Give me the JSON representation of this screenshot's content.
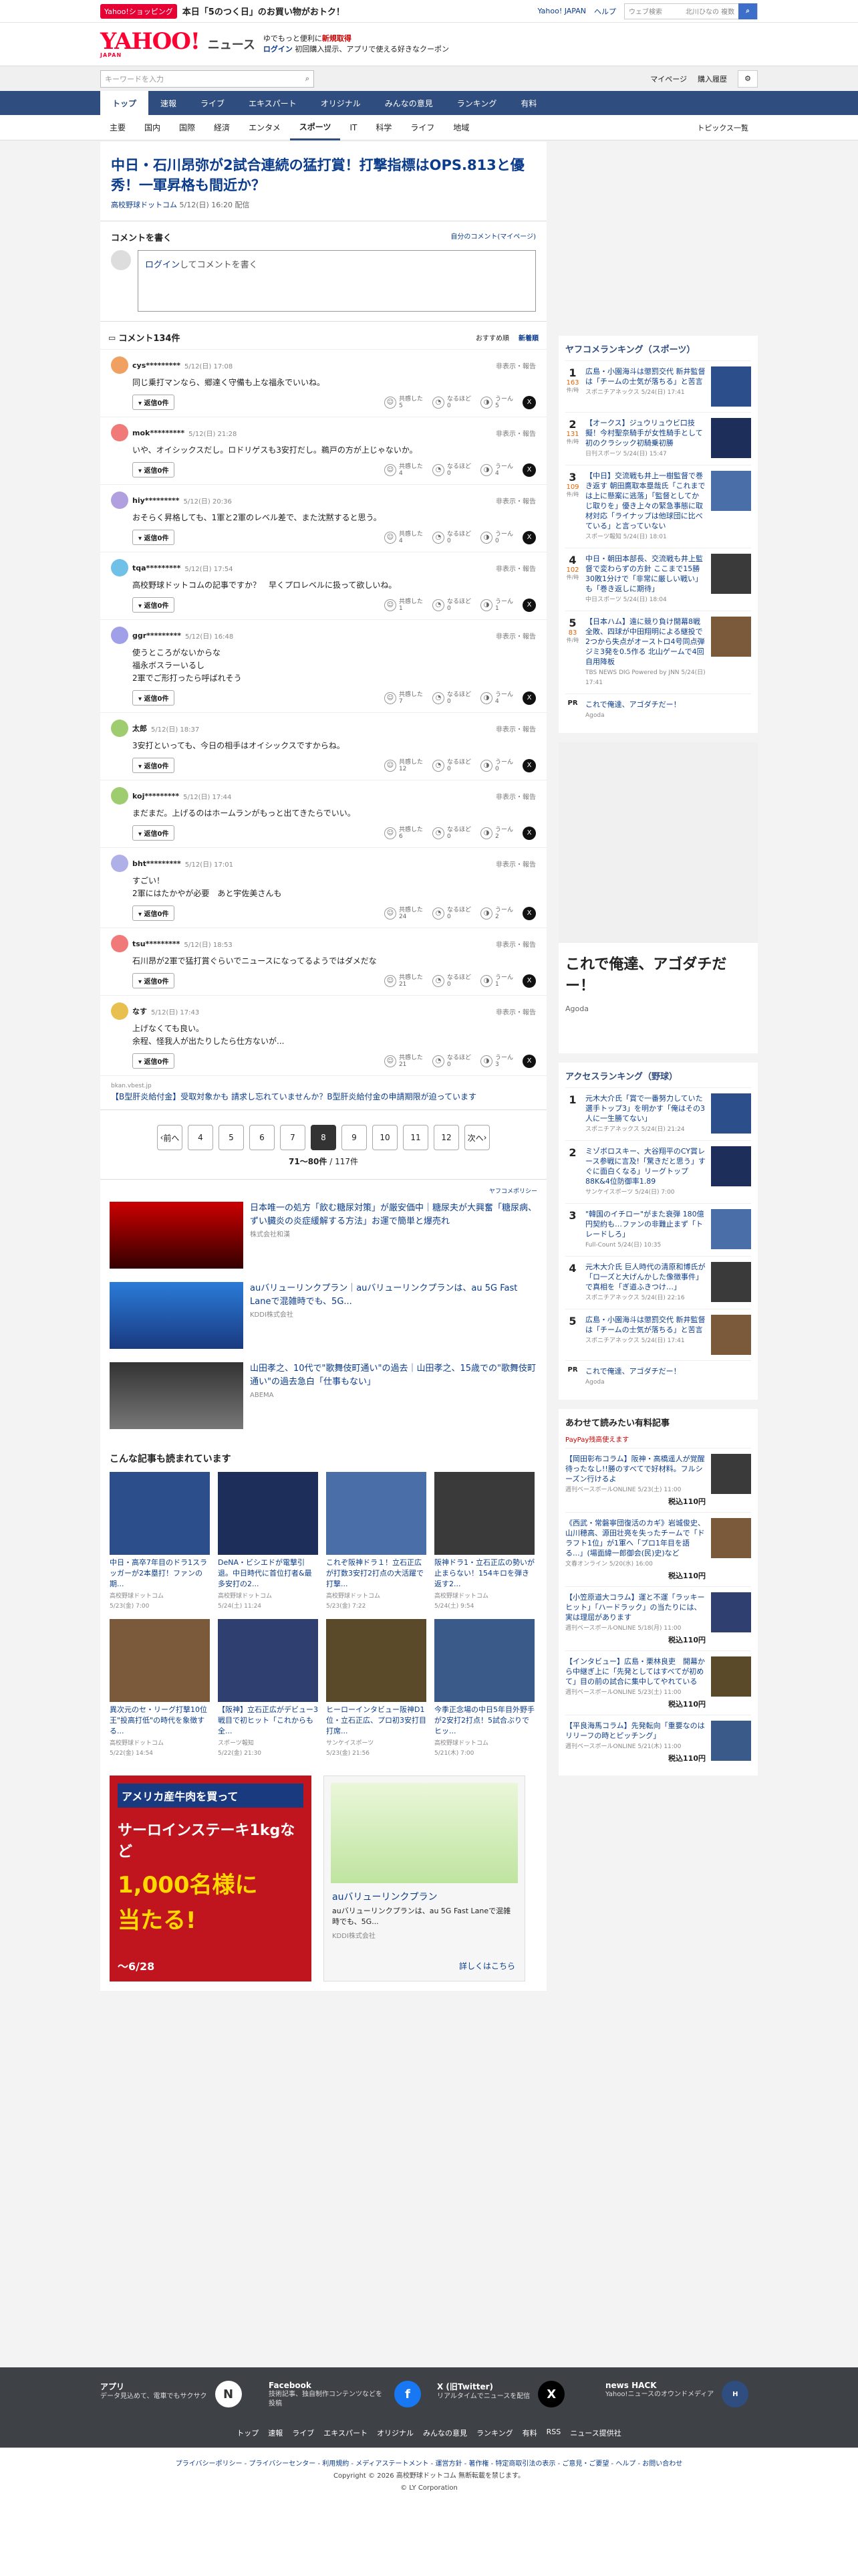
{
  "topbar": {
    "shop_badge": "Yahoo!ショッピング",
    "shop_text": "本日「5のつく日」のお買い物がおトク！",
    "links": [
      "Yahoo! JAPAN",
      "ヘルプ"
    ],
    "search_placeholder": "ウェブ検索",
    "search_suggest": "北川ひなの 複数"
  },
  "header": {
    "logo": "YAHOO!",
    "logo_sub": "JAPAN",
    "news": "ニュース",
    "promo1_a": "ゆでもっと便利に",
    "promo1_b": "新規取得",
    "promo2_a": "ログイン",
    "promo2_b": "初回購入提示、アプリで使える好きなクーポン"
  },
  "search": {
    "placeholder": "キーワードを入力",
    "mypage": "マイページ",
    "purchase": "購入履歴"
  },
  "catnav": [
    "トップ",
    "速報",
    "ライブ",
    "エキスパート",
    "オリジナル",
    "みんなの意見",
    "ランキング",
    "有料"
  ],
  "subnav": [
    "主要",
    "国内",
    "国際",
    "経済",
    "エンタメ",
    "スポーツ",
    "IT",
    "科学",
    "ライフ",
    "地域"
  ],
  "subnav_right": "トピックス一覧",
  "article": {
    "title": "中日・石川昂弥が2試合連続の猛打賞！打撃指標はOPS.813と優秀！一軍昇格も間近か？",
    "source": "高校野球ドットコム",
    "date": "5/12(日) 16:20 配信"
  },
  "comment_write": {
    "title": "コメントを書く",
    "mine": "自分のコメント(マイページ)",
    "login": "ログイン",
    "prompt": "してコメントを書く"
  },
  "comment_list": {
    "title": "コメント134件",
    "sort1": "おすすめ順",
    "sort2": "新着順"
  },
  "labels": {
    "flags": "非表示・報告",
    "reply": "返信0件",
    "r1": "共感した",
    "r2": "なるほど",
    "r3": "うーん"
  },
  "comments": [
    {
      "user": "cys*********",
      "date": "5/12(日) 17:08",
      "body": "同じ乗打マンなら、郷達く守備も上な福永でいいね。",
      "c": "5",
      "n": "0",
      "u": "5",
      "color": "#f0a060"
    },
    {
      "user": "mok*********",
      "date": "5/12(日) 21:28",
      "body": "いや、オイシックスだし。ロドリゲスも3安打だし。鵜戸の方が上じゃないか。",
      "c": "4",
      "n": "0",
      "u": "4",
      "color": "#f07a7a"
    },
    {
      "user": "hiy*********",
      "date": "5/12(日) 20:36",
      "body": "おそらく昇格しても、1軍と2軍のレベル差で、また沈黙すると思う。",
      "c": "4",
      "n": "0",
      "u": "0",
      "color": "#b0a0e0"
    },
    {
      "user": "tqa*********",
      "date": "5/12(日) 17:54",
      "body": "高校野球ドットコムの記事ですか？　早くプロレベルに扱って欲しいね。",
      "c": "1",
      "n": "0",
      "u": "1",
      "color": "#70c0e8"
    },
    {
      "user": "ggr*********",
      "date": "5/12(日) 16:48",
      "body": "使うところがないからな\n福永ボスラーいるし\n2軍でご形打ったら呼ばれそう",
      "c": "7",
      "n": "0",
      "u": "4",
      "color": "#a0a0e8"
    },
    {
      "user": "太郎",
      "date": "5/12(日) 18:37",
      "body": "3安打といっても、今日の相手はオイシックスですからね。",
      "c": "12",
      "n": "0",
      "u": "0",
      "color": "#a0cc70"
    },
    {
      "user": "koj*********",
      "date": "5/12(日) 17:44",
      "body": "まだまだ。上げるのはホームランがもっと出てきたらでいい。",
      "c": "6",
      "n": "0",
      "u": "2",
      "color": "#a0cc70"
    },
    {
      "user": "bht*********",
      "date": "5/12(日) 17:01",
      "body": "すごい！\n2軍にはたかやが必要　あと宇佐美さんも",
      "c": "24",
      "n": "0",
      "u": "2",
      "color": "#b0b0e8"
    },
    {
      "user": "tsu*********",
      "date": "5/12(日) 18:53",
      "body": "石川昂が2軍で猛打賞ぐらいでニュースになってるようではダメだな",
      "c": "21",
      "n": "0",
      "u": "1",
      "color": "#f07a7a"
    },
    {
      "user": "なす",
      "date": "5/12(日) 17:43",
      "body": "上げなくても良い。\n余程、怪我人が出たりしたら仕方ないが...",
      "c": "21",
      "n": "0",
      "u": "3",
      "color": "#e8c050"
    }
  ],
  "comment_ad": {
    "site": "bkan.vbest.jp",
    "text": "【B型肝炎給付金】受取対象かも 請求し忘れていませんか？B型肝炎給付金の申請期限が迫っています"
  },
  "pager": {
    "prev": "前へ",
    "pages": [
      "4",
      "5",
      "6",
      "7",
      "8",
      "9",
      "10",
      "11",
      "12"
    ],
    "current": "8",
    "next": "次へ",
    "count": "71〜80件",
    "total": "/ 117件"
  },
  "ads": {
    "label": "ヤフコメポリシー",
    "items": [
      {
        "title": "日本唯一の処方「飲む糖尿対策」が厳安価中｜糖尿夫が大興奮「糖尿病、ずい臓炎の炎症緩解する方法」お運で簡単と爆売れ",
        "sponsor": "株式会社和漢"
      },
      {
        "title": "auバリューリンクプラン｜auバリューリンクプランは、au 5G Fast Laneで混雑時でも、5G...",
        "sponsor": "KDDI株式会社"
      },
      {
        "title": "山田孝之、10代で\"歌舞伎町通い\"の過去｜山田孝之、15歳での\"歌舞伎町通い\"の過去急白「仕事もない」",
        "sponsor": "ABEMA"
      }
    ]
  },
  "reads": {
    "title": "こんな記事も読まれています",
    "items": [
      {
        "t": "中日・高卒7年目のドラ1スラッガーが2本塁打！ファンの期...",
        "s": "高校野球ドットコム",
        "d": "5/23(金) 7:00"
      },
      {
        "t": "DeNA・ビシエドが電撃引退。中日時代に首位打者&最多安打の2...",
        "s": "高校野球ドットコム",
        "d": "5/24(土) 11:24"
      },
      {
        "t": "これぞ阪神ドラ１！立石正広が打数3安打2打点の大活躍で打撃...",
        "s": "高校野球ドットコム",
        "d": "5/23(金) 7:22"
      },
      {
        "t": "阪神ドラ1・立石正広の勢いが止まらない！154キロを弾き返す2...",
        "s": "高校野球ドットコム",
        "d": "5/24(土) 9:54"
      },
      {
        "t": "異次元のセ・リーグ打撃10位王\"投高打低\"の時代を象徴する...",
        "s": "高校野球ドットコム",
        "d": "5/22(金) 14:54"
      },
      {
        "t": "【阪神】立石正広がデビュー3戦目で初ヒット「これからも全...",
        "s": "スポーツ報知",
        "d": "5/22(金) 21:30"
      },
      {
        "t": "ヒーローインタビュー阪神D1位・立石正広、プロ初3安打目打席...",
        "s": "サンケイスポーツ",
        "d": "5/23(金) 21:56"
      },
      {
        "t": "今季正念場の中日5年目外野手が2安打2打点！5試合ぶりでヒッ...",
        "s": "高校野球ドットコム",
        "d": "5/21(木) 7:00"
      }
    ]
  },
  "banners": {
    "b1_line1": "アメリカ産牛肉を買って",
    "b1_line2": "サーロインステーキ1kgなど",
    "b1_line3": "1,000名様に",
    "b1_line4": "当たる!",
    "b1_date": "〜6/28",
    "b2_title": "auバリューリンクプラン",
    "b2_desc": "auバリューリンクプランは、au 5G Fast Laneで混雑時でも、5G...",
    "b2_sponsor": "KDDI株式会社",
    "b2_more": "詳しくはこちら"
  },
  "side_rank1": {
    "title": "ヤフコメランキング（スポーツ）",
    "items": [
      {
        "n": "1",
        "c": "163",
        "unit": "件/時",
        "t": "広島・小園海斗は懲罰交代 新井監督は「チームの士気が落ちる」と苦言",
        "s": "スポニチアネックス",
        "d": "5/24(日) 17:41"
      },
      {
        "n": "2",
        "c": "131",
        "unit": "件/時",
        "t": "【オークス】ジュウリュウビ口技擬！今村聖奈騎手が女性騎手として初のクラシック初騎乗初勝",
        "s": "日刊スポーツ",
        "d": "5/24(日) 15:47"
      },
      {
        "n": "3",
        "c": "109",
        "unit": "件/時",
        "t": "【中日】交流戦も井上一樹監督で巻き返す 朝田鷹取本塁哉氏「これまでは上に懸案に逃落」「監督としてかじ取りを」優き上々の緊急事態に取材対応「ライナップは他球団に比べている」と言っていない",
        "s": "スポーツ報知",
        "d": "5/24(日) 18:01"
      },
      {
        "n": "4",
        "c": "102",
        "unit": "件/時",
        "t": "中日・朝田本部長、交流戦も井上監督で変わらずの方針 ここまで15勝30敗1分けで「非常に厳しい戦い」も「巻き返しに期待」",
        "s": "中日スポーツ",
        "d": "5/24(日) 18:04"
      },
      {
        "n": "5",
        "c": "83",
        "unit": "件/時",
        "t": "【日本ハム】遠に競り負け開幕8戦全敗、四球が中田翔明による継投で2つから失点がオーストロ4号同点弾ジミ3発を0.5作る 北山ゲームで4回自用降板",
        "s": "TBS NEWS DIG Powered by JNN",
        "d": "5/24(日) 17:41"
      }
    ],
    "pr": "これで俺達、アゴダチだー！",
    "pr_src": "Agoda"
  },
  "side_ad": {
    "text": "これで俺達、アゴダチだー！",
    "src": "Agoda"
  },
  "side_rank2": {
    "title": "アクセスランキング（野球）",
    "items": [
      {
        "n": "1",
        "t": "元木大介氏「賞で一番努力していた選手トップ3」を明かす「俺はその3人に一生勝てない」",
        "s": "スポニチアネックス",
        "d": "5/24(日) 21:24"
      },
      {
        "n": "2",
        "t": "ミゾボロスキー、大谷翔平のCY賞レース参戦に言及!「驚きだと思う」すぐに面白くなる」リーグトップ88K&4位防御率1.89",
        "s": "サンケイスポーツ",
        "d": "5/24(日) 7:00"
      },
      {
        "n": "3",
        "t": "\"韓国のイチロー\"がまた衰弾 180億円契約も…ファンの非難止まず「トレードしろ」",
        "s": "Full-Count",
        "d": "5/24(日) 10:35"
      },
      {
        "n": "4",
        "t": "元木大介氏 巨人時代の清原和博氏が「ロ一ズと大げんかした像徴事件」で真相を「ぎ道ふきつけ…」",
        "s": "スポニチアネックス",
        "d": "5/24(日) 22:16"
      },
      {
        "n": "5",
        "t": "広島・小園海斗は懲罰交代 新井監督は「チームの士気が落ちる」と苦言",
        "s": "スポニチアネックス",
        "d": "5/24(日) 17:41"
      }
    ],
    "pr": "これで俺達、アゴダチだー！",
    "pr_src": "Agoda"
  },
  "side_paid": {
    "title": "あわせて読みたい有料記事",
    "badge": "PayPay残高使えます",
    "items": [
      {
        "t": "【岡田彰布コラム】阪神・高橋遥人が覚醒待ったなし!!勝のすべてで好材料。フルシーズン行けるよ",
        "s": "週刊ベースボールONLINE 5/23(土) 11:00",
        "p": "税込110円"
      },
      {
        "t": "《西武・常磐寧団復活のカギ》岩城俊史、山川穂高、源田壮亮を失ったチームで「ドラフト1位」が1軍へ「プロ1年目を語る...」(場面緯一郎御会(民)史)など",
        "s": "文春オンライン 5/20(水) 16:00",
        "p": "税込110円"
      },
      {
        "t": "【小笠原道大コラム】運と不運「ラッキーヒット」「ハードラック」の当たりには、実は理屈があります",
        "s": "週刊ベースボールONLINE 5/18(月) 11:00",
        "p": "税込110円"
      },
      {
        "t": "【インタビュー】広島・栗林良吏　開幕から中継ぎ上に「先発としてはすべてが初めて」目の前の試合に集中してやれている",
        "s": "週刊ベースボールONLINE 5/23(土) 11:00",
        "p": "税込110円"
      },
      {
        "t": "【平良海馬コラム】先発転向「重要なのはリリーフの時とピッチング」",
        "s": "週刊ベースボールONLINE 5/21(木) 11:00",
        "p": "税込110円"
      }
    ]
  },
  "footer": {
    "cols": [
      {
        "t": "アプリ",
        "d": "データ見込めて、電車でもサクサク"
      },
      {
        "t": "Facebook",
        "d": "技術記事、独自制作コンテンツなどを投稿"
      },
      {
        "t": "X (旧Twitter)",
        "d": "リアルタイムでニュースを配信"
      },
      {
        "t": "news HACK",
        "d": "Yahoo!ニュースのオウンドメディア"
      }
    ],
    "links": [
      "トップ",
      "速報",
      "ライブ",
      "エキスパート",
      "オリジナル",
      "みんなの意見",
      "ランキング",
      "有料",
      "RSS",
      "ニュース提供社"
    ],
    "legal": "プライバシーポリシー - プライバシーセンター - 利用規約 - メディアステートメント - 運営方針 - 著作権 - 特定商取引法の表示 - ご意見・ご要望 - ヘルプ - お問い合わせ",
    "copy1": "Copyright © 2026 高校野球ドットコム 無断転載を禁じます。",
    "copy2": "© LY Corporation"
  }
}
